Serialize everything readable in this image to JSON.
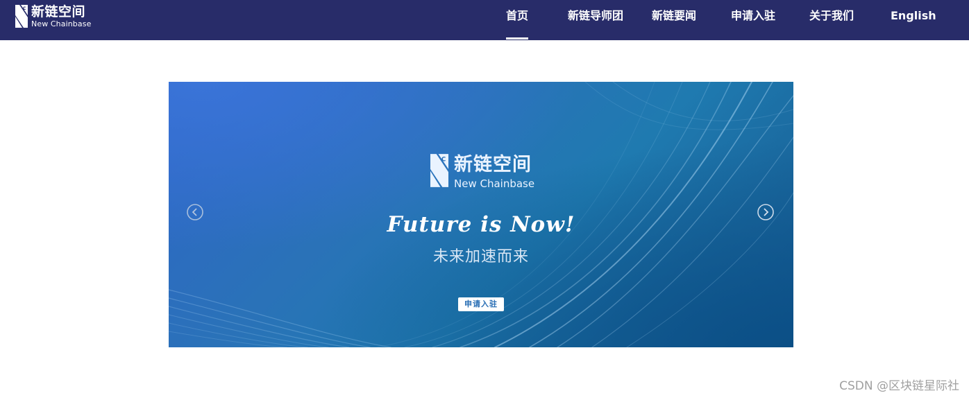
{
  "header": {
    "logo": {
      "name_cn": "新链空间",
      "name_en": "New Chainbase"
    },
    "nav": [
      {
        "label": "首页",
        "active": true
      },
      {
        "label": "新链导师团",
        "active": false
      },
      {
        "label": "新链要闻",
        "active": false
      },
      {
        "label": "申请入驻",
        "active": false
      },
      {
        "label": "关于我们",
        "active": false
      },
      {
        "label": "English",
        "active": false
      }
    ],
    "colors": {
      "background": "#282c69",
      "text": "#ffffff"
    }
  },
  "banner": {
    "logo": {
      "name_cn": "新链空间",
      "name_en": "New Chainbase"
    },
    "slogan": "Future is Now!",
    "subtitle": "未来加速而来",
    "cta_label": "申请入驻",
    "prev_icon": "chevron-left-circle-icon",
    "next_icon": "chevron-right-circle-icon",
    "colors": {
      "primary": "#2a72b8",
      "button_text": "#2a6fb5"
    }
  },
  "watermark": "CSDN @区块链星际社"
}
